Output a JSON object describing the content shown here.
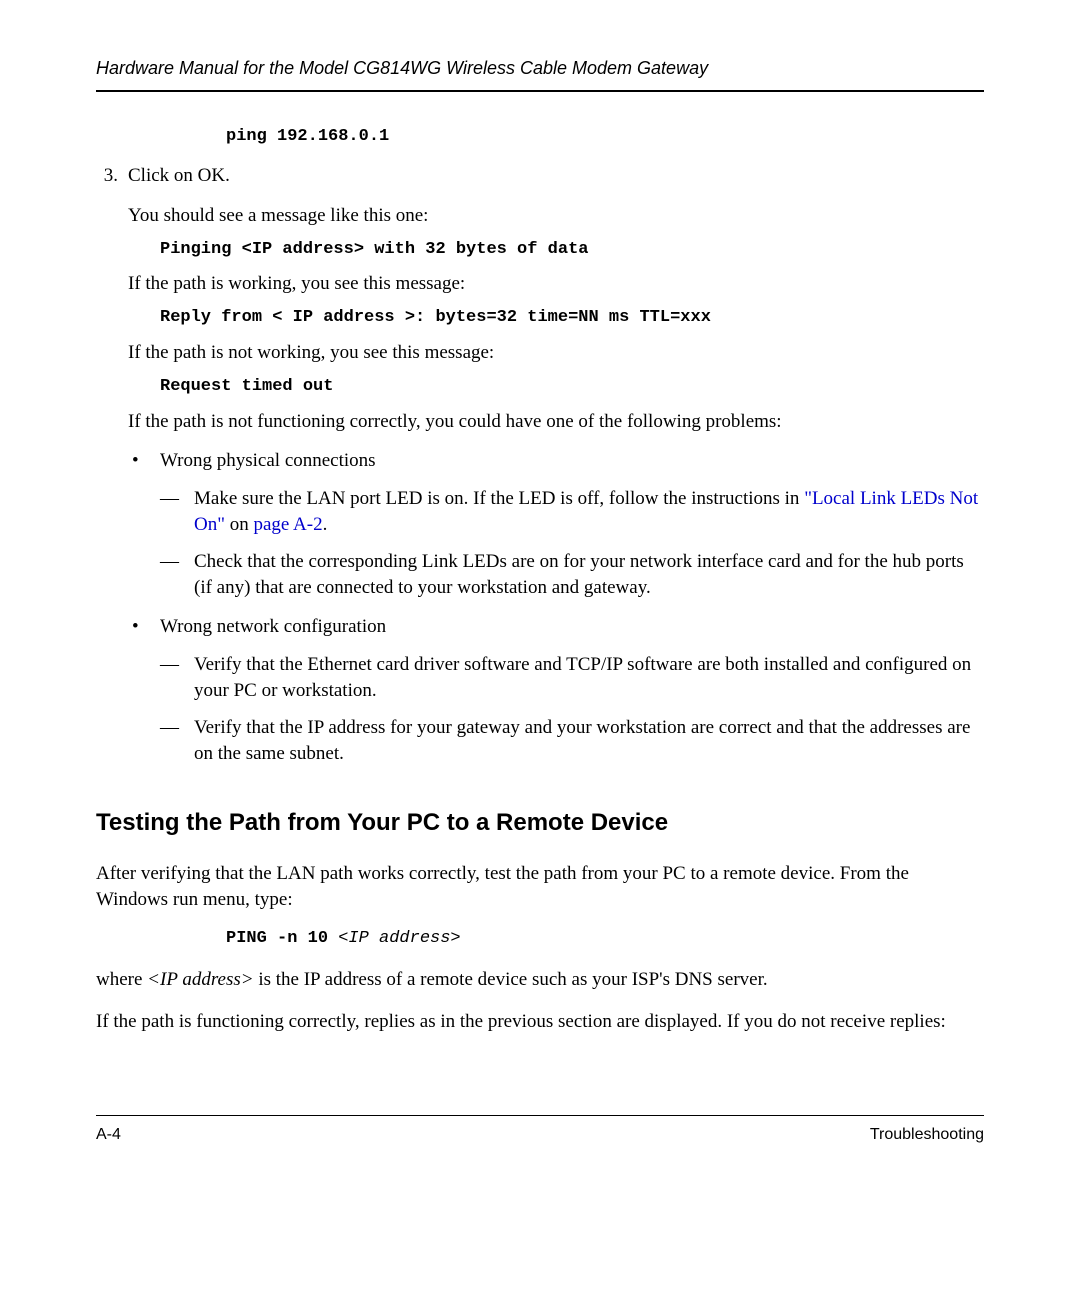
{
  "header": "Hardware Manual for the Model CG814WG Wireless Cable Modem Gateway",
  "code1": "ping 192.168.0.1",
  "step3_num": "3.",
  "step3_text": "Click on OK.",
  "p1": "You should see a message like this one:",
  "code2": "Pinging <IP address> with 32 bytes of data",
  "p2": "If the path is working, you see this message:",
  "code3": "Reply from < IP address >: bytes=32 time=NN ms TTL=xxx",
  "p3": "If the path is not working, you see this message:",
  "code4": "Request timed out",
  "p4": "If the path is not functioning correctly, you could have one of the following problems:",
  "b1": "Wrong physical connections",
  "b1_d1_pre": "Make sure the LAN port LED is on. If the LED is off, follow the instructions in ",
  "b1_d1_link1": "\"Local Link LEDs Not On\"",
  "b1_d1_mid": " on ",
  "b1_d1_link2": "page A-2",
  "b1_d1_post": ".",
  "b1_d2": "Check that the corresponding Link LEDs are on for your network interface card and for the hub ports (if any) that are connected to your workstation and gateway.",
  "b2": "Wrong network configuration",
  "b2_d1": "Verify that the Ethernet card driver software and TCP/IP software are both installed and configured on your PC or workstation.",
  "b2_d2": "Verify that the IP address for your gateway and your workstation are correct and that the addresses are on the same subnet.",
  "section_heading": "Testing the Path from Your PC to a Remote Device",
  "sp1": "After verifying that the LAN path works correctly, test the path from your PC to a remote device. From the Windows run menu, type:",
  "scode_a": "PING -n 10 ",
  "scode_b": "<IP address>",
  "sp2_a": "where ",
  "sp2_b": "<IP address>",
  "sp2_c": " is the IP address of a remote device such as your ISP's DNS server.",
  "sp3": "If the path is functioning correctly, replies as in the previous section are displayed. If you do not receive replies:",
  "footer_left": "A-4",
  "footer_right": "Troubleshooting",
  "bullet_char": "•",
  "dash_char": "—"
}
